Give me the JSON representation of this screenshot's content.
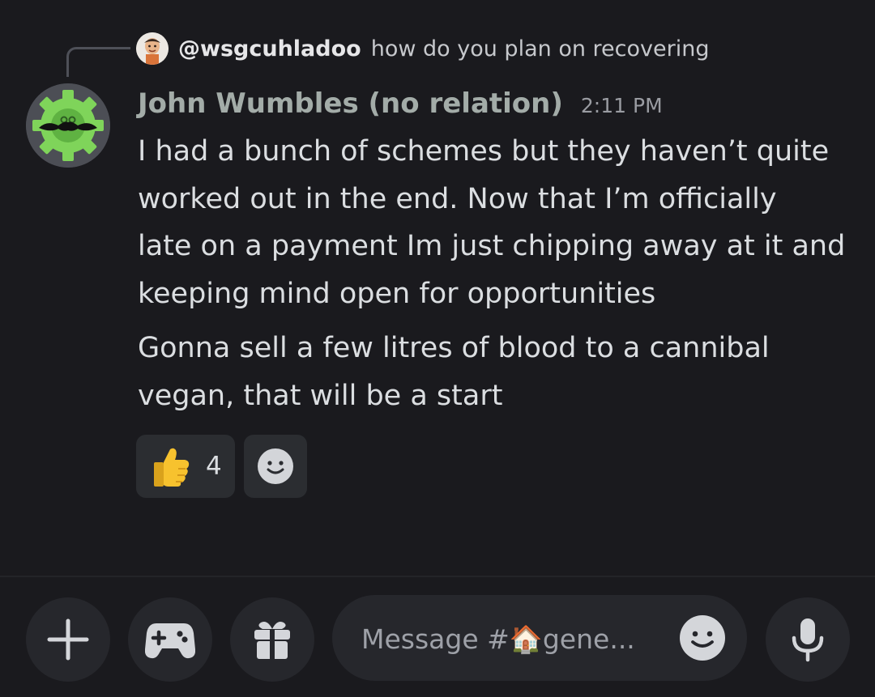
{
  "reply": {
    "username": "@wsgcuhladoo",
    "text": "how do you plan on recovering"
  },
  "message": {
    "author": "John Wumbles (no relation)",
    "timestamp": "2:11 PM",
    "lines": [
      "I had a bunch of schemes but they haven’t quite\nworked out in the end. Now that I’m officially\nlate on a payment Im just chipping away at it and\nkeeping mind open for opportunities",
      "Gonna sell a few litres of blood to a cannibal\nvegan, that will be a start"
    ]
  },
  "reactions": [
    {
      "emoji": "thumbs-up",
      "count": "4"
    }
  ],
  "composer": {
    "placeholder": "Message #🏠gene..."
  },
  "icons": {
    "plus": "plus-icon",
    "game": "gamepad-icon",
    "gift": "gift-icon",
    "emoji": "smiley-icon",
    "mic": "microphone-icon"
  },
  "colors": {
    "background": "#1a1a1e",
    "surface": "#26272c",
    "reaction_bg": "#2b2d31",
    "author_name": "#a3aca8",
    "avatar_gear": "#7fd45a"
  }
}
